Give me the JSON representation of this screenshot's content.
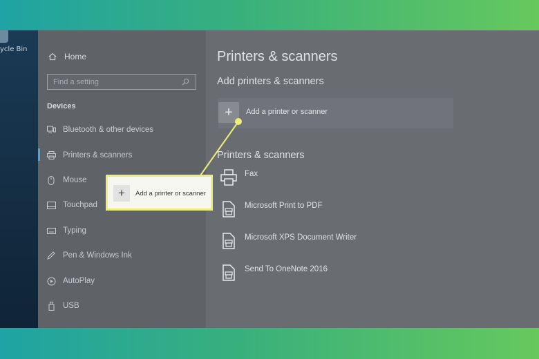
{
  "desktop": {
    "recycle_bin_label": "ycle Bin"
  },
  "nav": {
    "home": "Home",
    "search_placeholder": "Find a setting",
    "section": "Devices",
    "items": [
      {
        "label": "Bluetooth & other devices",
        "icon": "bluetooth-devices-icon"
      },
      {
        "label": "Printers & scanners",
        "icon": "printer-icon"
      },
      {
        "label": "Mouse",
        "icon": "mouse-icon"
      },
      {
        "label": "Touchpad",
        "icon": "touchpad-icon"
      },
      {
        "label": "Typing",
        "icon": "keyboard-icon"
      },
      {
        "label": "Pen & Windows Ink",
        "icon": "pen-icon"
      },
      {
        "label": "AutoPlay",
        "icon": "autoplay-icon"
      },
      {
        "label": "USB",
        "icon": "usb-icon"
      }
    ]
  },
  "content": {
    "title": "Printers & scanners",
    "add_section_title": "Add printers & scanners",
    "add_button_label": "Add a printer or scanner",
    "list_section_title": "Printers & scanners",
    "printers": [
      {
        "label": "Fax",
        "icon": "fax-icon"
      },
      {
        "label": "Microsoft Print to PDF",
        "icon": "document-printer-icon"
      },
      {
        "label": "Microsoft XPS Document Writer",
        "icon": "document-printer-icon"
      },
      {
        "label": "Send To OneNote 2016",
        "icon": "document-printer-icon"
      }
    ]
  },
  "callout": {
    "label": "Add a printer or scanner"
  },
  "colors": {
    "highlight": "#ecee7a",
    "accent": "#5aa0d0"
  }
}
